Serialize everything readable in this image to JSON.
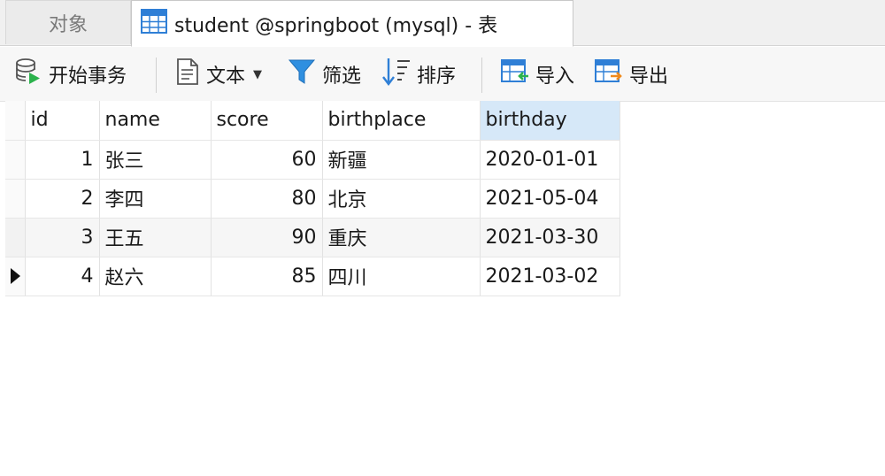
{
  "tabs": {
    "objects_label": "对象",
    "active_label": "student @springboot (mysql) - 表"
  },
  "toolbar": {
    "begin_transaction": "开始事务",
    "text": "文本",
    "filter": "筛选",
    "sort": "排序",
    "import": "导入",
    "export": "导出"
  },
  "grid": {
    "columns": [
      "id",
      "name",
      "score",
      "birthplace",
      "birthday"
    ],
    "selected_column": "birthday",
    "rows": [
      {
        "id": "1",
        "name": "张三",
        "score": "60",
        "birthplace": "新疆",
        "birthday": "2020-01-01"
      },
      {
        "id": "2",
        "name": "李四",
        "score": "80",
        "birthplace": "北京",
        "birthday": "2021-05-04"
      },
      {
        "id": "3",
        "name": "王五",
        "score": "90",
        "birthplace": "重庆",
        "birthday": "2021-03-30"
      },
      {
        "id": "4",
        "name": "赵六",
        "score": "85",
        "birthplace": "四川",
        "birthday": "2021-03-02"
      }
    ],
    "current_row": 4
  },
  "icons": {
    "table_tab": "table-icon",
    "begin_transaction": "database-transaction-icon",
    "text": "document-icon",
    "filter": "funnel-icon",
    "sort": "sort-icon",
    "import": "table-import-icon",
    "export": "table-export-icon"
  },
  "colors": {
    "accent_blue": "#2f7fd6",
    "selected_header": "#d6e8f8",
    "transaction_green": "#2bb24c"
  }
}
